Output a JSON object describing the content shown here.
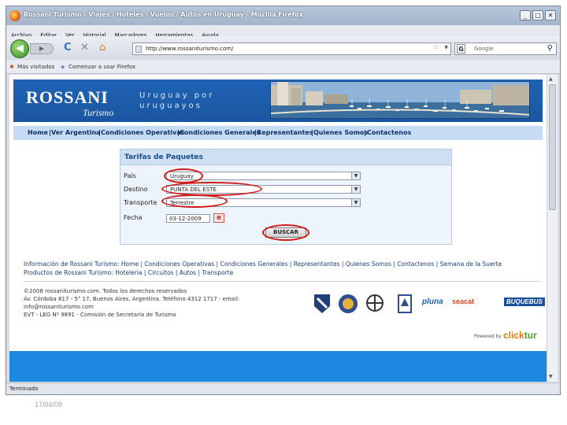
{
  "window": {
    "title": "Rossani Turismo - Viajes / Hoteles / Vuelos / Autos en Uruguay - Mozilla Firefox",
    "controls": {
      "minimize": "_",
      "maximize": "□",
      "close": "✕"
    }
  },
  "menu": {
    "items": [
      "Archivo",
      "Editar",
      "Ver",
      "Historial",
      "Marcadores",
      "Herramientas",
      "Ayuda"
    ]
  },
  "nav": {
    "url": "http://www.rossaniturismo.com/",
    "search_placeholder": "Google",
    "icons": {
      "back": "◀",
      "forward": "▶",
      "reload": "C",
      "stop": "✕",
      "home": "⌂",
      "star": "☆",
      "search": "🔍"
    }
  },
  "bookmarks": {
    "items": [
      "Más visitados",
      "Comenzar a usar Firefox"
    ]
  },
  "site": {
    "logo": {
      "main": "ROSSANI",
      "sub": "Turismo"
    },
    "tagline": {
      "line1": "Uruguay por",
      "line2": "uruguayos"
    },
    "nav_links": [
      "Home",
      "Ver Argentina",
      "Condiciones Operativas",
      "Condiciones Generales",
      "Representantes",
      "Quienes Somos",
      "Contactenos"
    ],
    "form": {
      "title": "Tarifas de Paquetes",
      "fields": [
        {
          "label": "País",
          "value": "Uruguay"
        },
        {
          "label": "Destino",
          "value": "PUNTA DEL ESTE"
        },
        {
          "label": "Transporte",
          "value": "Terrestre"
        },
        {
          "label": "Fecha",
          "value": "03-12-2009"
        }
      ],
      "calendar_icon": "▦",
      "submit": "BUSCAR"
    },
    "footer_links_1": "Información de Rossani Turismo: Home | Condiciones Operativas | Condiciones Generales | Representantes | Quienes Somos | Contactenos | Semana de la Suerte",
    "footer_links_2": "Productos de Rossani Turismo: Hoteleria | Circuitos | Autos | Transporte",
    "copyright": [
      "©2008 rossaniturismo.com. Todos los derechos reservados",
      "Av. Córdoba 817 - 5° 17, Buenos Aires, Argentina. Teléfono 4312 1717 - email:",
      "info@rossaniturismo.com",
      "EVT - LEG Nº 9891 - Comisión de Secretaría de Turismo"
    ],
    "partners": [
      "pluna",
      "seacat",
      "BUQUEBUS"
    ],
    "powered_by": "Powered by",
    "clicktur": {
      "click": "click",
      "tur": "tur"
    }
  },
  "status": {
    "text": "Terminado"
  },
  "slide_date": "17/04/09",
  "colors": {
    "banner": "#1f63b5",
    "highlight_ring": "#d11a1a",
    "footer_blue": "#1e88e0"
  }
}
